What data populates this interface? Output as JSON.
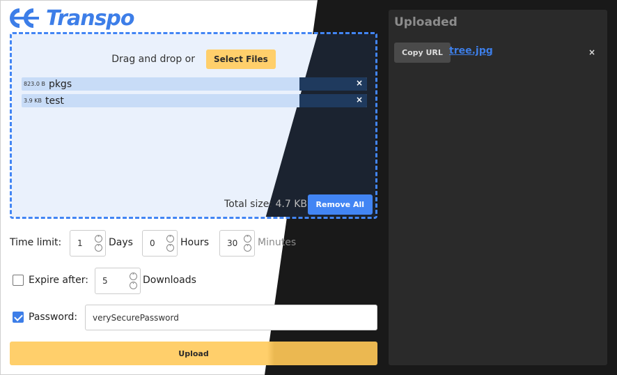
{
  "brand": {
    "name": "Transpo",
    "color": "#3d7ee8"
  },
  "dropzone": {
    "prompt": "Drag and drop or",
    "select_label": "Select Files",
    "files": [
      {
        "size": "823.0 B",
        "name": "pkgs",
        "remove": "×"
      },
      {
        "size": "3.9 KB",
        "name": "test",
        "remove": "×"
      }
    ],
    "total_label": "Total size: ",
    "total_value": "4.7 KB",
    "remove_all_label": "Remove All"
  },
  "form": {
    "time_limit_label": "Time limit:",
    "days_value": "1",
    "days_label": "Days",
    "hours_value": "0",
    "hours_label": "Hours",
    "minutes_value": "30",
    "minutes_label": "Minutes",
    "expire_label": "Expire after:",
    "expire_checked": false,
    "downloads_value": "5",
    "downloads_label": "Downloads",
    "password_label": "Password:",
    "password_checked": true,
    "password_value": "verySecurePassword",
    "upload_label": "Upload"
  },
  "uploaded": {
    "title": "Uploaded",
    "copy_label": "Copy URL",
    "files": [
      {
        "name": "tree.jpg",
        "remove": "×"
      }
    ]
  },
  "colors": {
    "accent": "#4285f4",
    "button_yellow": "#ffcf6b",
    "panel_dark": "#2a2a2a"
  }
}
